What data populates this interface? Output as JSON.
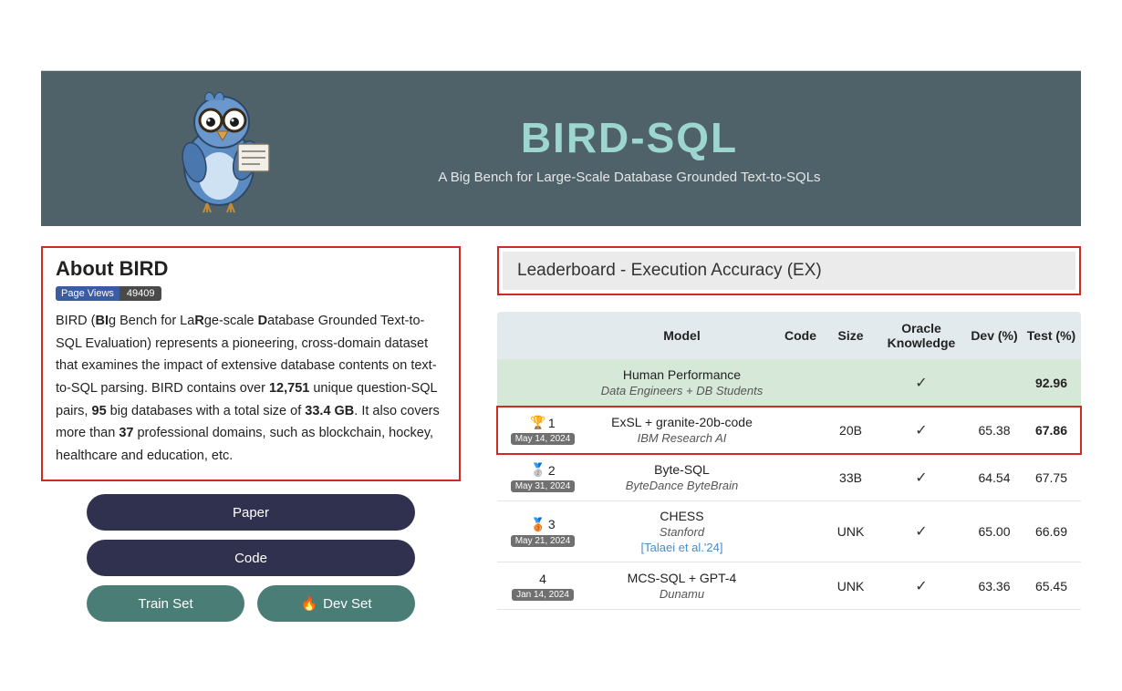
{
  "hero": {
    "title": "BIRD-SQL",
    "subtitle": "A Big Bench for Large-Scale Database Grounded Text-to-SQLs"
  },
  "about": {
    "heading": "About BIRD",
    "badge_label": "Page Views",
    "badge_count": "49409",
    "body_html": "BIRD (<b>BI</b>g Bench for La<b>R</b>ge-scale <b>D</b>atabase Grounded Text-to-SQL Evaluation) represents a pioneering, cross-domain dataset that examines the impact of extensive database contents on text-to-SQL parsing. BIRD contains over <b>12,751</b> unique question-SQL pairs, <b>95</b> big databases with a total size of <b>33.4 GB</b>. It also covers more than <b>37</b> professional domains, such as blockchain, hockey, healthcare and education, etc."
  },
  "buttons": {
    "paper": "Paper",
    "code": "Code",
    "train": "Train Set",
    "dev": "Dev Set",
    "fire_icon": "🔥"
  },
  "leaderboard": {
    "title": "Leaderboard - Execution Accuracy (EX)",
    "headers": {
      "model": "Model",
      "code": "Code",
      "size": "Size",
      "oracle": "Oracle Knowledge",
      "dev": "Dev (%)",
      "test": "Test (%)"
    },
    "human": {
      "name": "Human Performance",
      "sub": "Data Engineers + DB Students",
      "oracle": "✓",
      "test": "92.96"
    },
    "rows": [
      {
        "medal": "🏆",
        "rank": "1",
        "date": "May 14, 2024",
        "model": "ExSL + granite-20b-code",
        "sub": "IBM Research AI",
        "link": "",
        "size": "20B",
        "oracle": "✓",
        "dev": "65.38",
        "test": "67.86",
        "test_bold": true,
        "highlight": true
      },
      {
        "medal": "🥈",
        "rank": "2",
        "date": "May 31, 2024",
        "model": "Byte-SQL",
        "sub": "ByteDance ByteBrain",
        "link": "",
        "size": "33B",
        "oracle": "✓",
        "dev": "64.54",
        "test": "67.75",
        "test_bold": false,
        "highlight": false
      },
      {
        "medal": "🥉",
        "rank": "3",
        "date": "May 21, 2024",
        "model": "CHESS",
        "sub": "Stanford",
        "link": "[Talaei et al.'24]",
        "size": "UNK",
        "oracle": "✓",
        "dev": "65.00",
        "test": "66.69",
        "test_bold": false,
        "highlight": false
      },
      {
        "medal": "",
        "rank": "4",
        "date": "Jan 14, 2024",
        "model": "MCS-SQL + GPT-4",
        "sub": "Dunamu",
        "link": "",
        "size": "UNK",
        "oracle": "✓",
        "dev": "63.36",
        "test": "65.45",
        "test_bold": false,
        "highlight": false
      }
    ]
  }
}
